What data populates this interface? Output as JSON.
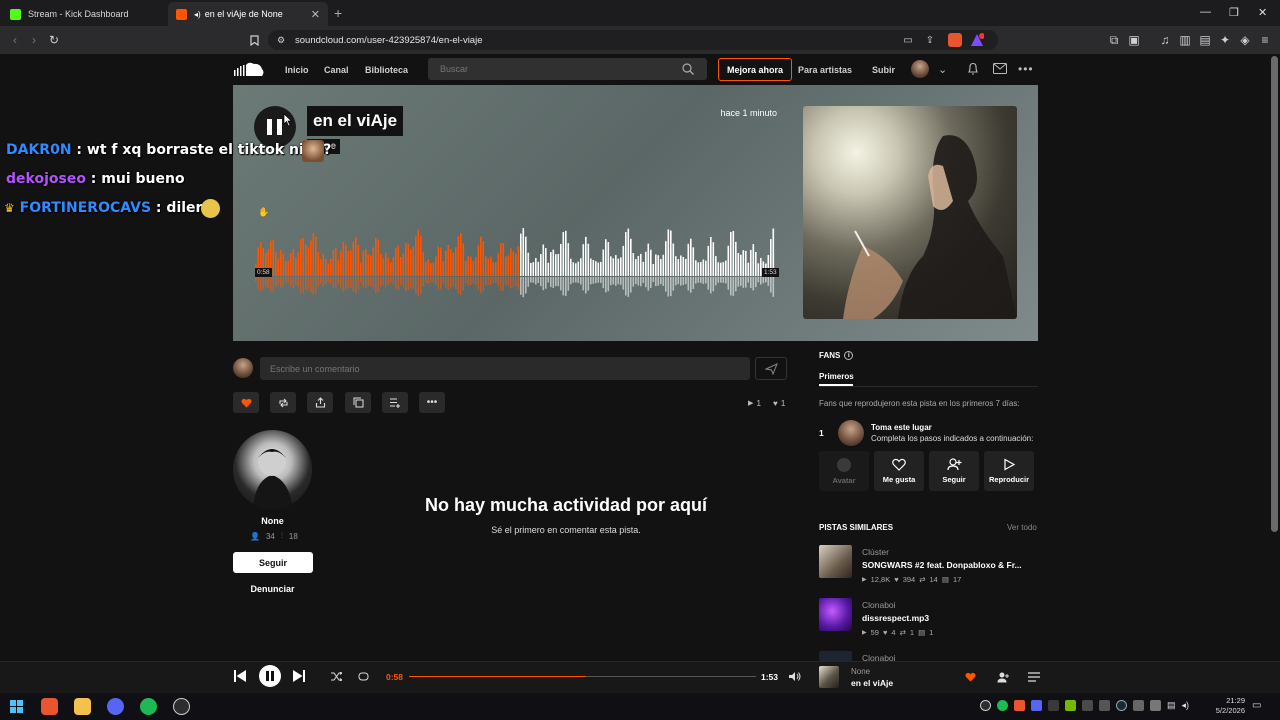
{
  "browser": {
    "tabs": [
      {
        "title": "Stream - Kick Dashboard",
        "favicon_color": "#53fc18"
      },
      {
        "title": "en el viAje de None",
        "favicon_color": "#ff5500",
        "active": true
      }
    ],
    "url": "soundcloud.com/user-423925874/en-el-viaje"
  },
  "chat_overlay": [
    {
      "user": "DAKR0N",
      "sep": " : ",
      "message": "wt f xq borraste el tiktok niga?",
      "user_color": "#2f8bff"
    },
    {
      "user": "dekojoseo",
      "sep": " : ",
      "message": "mui bueno",
      "user_color": "#b452ff"
    },
    {
      "user": "FORTINEROCAVS",
      "sep": " : ",
      "message": "diler",
      "user_color": "#2f8bff"
    }
  ],
  "header": {
    "nav": [
      "Inicio",
      "Canal",
      "Biblioteca"
    ],
    "search_placeholder": "Buscar",
    "upgrade": "Mejora ahora",
    "for_artists": "Para artistas",
    "upload": "Subir"
  },
  "track": {
    "title": "en el viAje",
    "artist": "None",
    "posted": "hace 1 minuto",
    "time_current": "0:58",
    "time_total": "1:53",
    "progress": 0.51
  },
  "comment": {
    "placeholder": "Escribe un comentario"
  },
  "stats": {
    "plays": "1",
    "likes": "1"
  },
  "uploader": {
    "name": "None",
    "followers": "34",
    "tracks": "18",
    "follow": "Seguir",
    "report": "Denunciar"
  },
  "empty_state": {
    "title": "No hay mucha actividad por aquí",
    "subtitle": "Sé el primero en comentar esta pista."
  },
  "fans": {
    "heading": "FANS",
    "tab": "Primeros",
    "description": "Fans que reprodujeron esta pista en los primeros 7 días:",
    "rank": "1",
    "cta_title": "Toma este lugar",
    "cta_text": "Completa los pasos indicados a continuación:",
    "steps": [
      "Avatar",
      "Me gusta",
      "Seguir",
      "Reproducir"
    ]
  },
  "similar": {
    "heading": "PISTAS SIMILARES",
    "see_all": "Ver todo",
    "tracks": [
      {
        "artist": "Clúster",
        "title": "SONGWARS #2 feat. Donpabloxo & Fr...",
        "plays": "12,8K",
        "likes": "394",
        "reposts": "14",
        "comments": "17"
      },
      {
        "artist": "Clonaboi",
        "title": "dissrespect.mp3",
        "plays": "59",
        "likes": "4",
        "reposts": "1",
        "comments": "1"
      },
      {
        "artist": "Clonaboi"
      }
    ]
  },
  "player": {
    "current": "0:58",
    "total": "1:53",
    "progress": 0.51,
    "artist": "None",
    "title": "en el viAje"
  },
  "taskbar": {
    "time": "21:29",
    "date": "5/2/2026"
  },
  "colors": {
    "accent": "#ff5500",
    "background": "#121212"
  }
}
